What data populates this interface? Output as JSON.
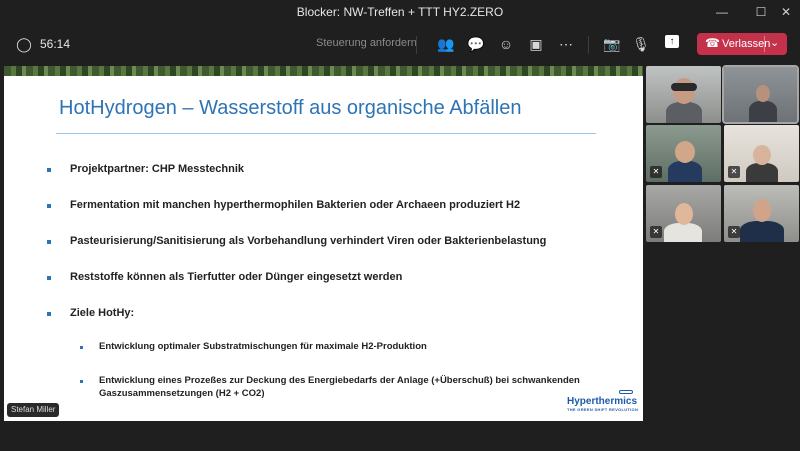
{
  "window": {
    "title": "Blocker: NW-Treffen + TTT HY2.ZERO",
    "minimize_glyph": "—",
    "maximize_glyph": "☐",
    "close_glyph": "✕"
  },
  "toolbar": {
    "elapsed_time": "56:14",
    "request_control_label": "Steuerung anfordern",
    "leave_label": "Verlassen",
    "icons": {
      "shield": "◯",
      "people": "👥",
      "chat": "💬",
      "reactions": "☺",
      "rooms": "▣",
      "more": "⋯",
      "camera_off": "📷",
      "mic_off": "🎙",
      "share": "↑",
      "phone": "☎",
      "chevron": "⌄"
    }
  },
  "slide": {
    "title": "HotHydrogen – Wasserstoff aus organische Abfällen",
    "bullets": [
      "Projektpartner: CHP Messtechnik",
      "Fermentation mit manchen hyperthermophilen Bakterien oder Archaeen produziert H2",
      "Pasteurisierung/Sanitisierung als Vorbehandlung verhindert Viren oder Bakterienbelastung",
      "Reststoffe können als Tierfutter oder Dünger eingesetzt werden",
      "Ziele HotHy:"
    ],
    "sub_bullets": [
      "Entwicklung optimaler Substratmischungen für maximale H2-Produktion",
      "Entwicklung eines Prozeßes zur Deckung des Energiebedarfs der Anlage (+Überschuß) bei schwankenden",
      "Gaszusammensetzungen (H2 + CO2)"
    ],
    "logo_text": "Hyperthermics",
    "logo_tagline": "THE GREEN SHIFT REVOLUTION",
    "brand_color": "#2e74b5"
  },
  "presenter": {
    "name": "Stefan Miller"
  },
  "participants": {
    "muted_glyph": "✕"
  },
  "colors": {
    "leave_button": "#c4314b",
    "background": "#1f1f1f"
  }
}
